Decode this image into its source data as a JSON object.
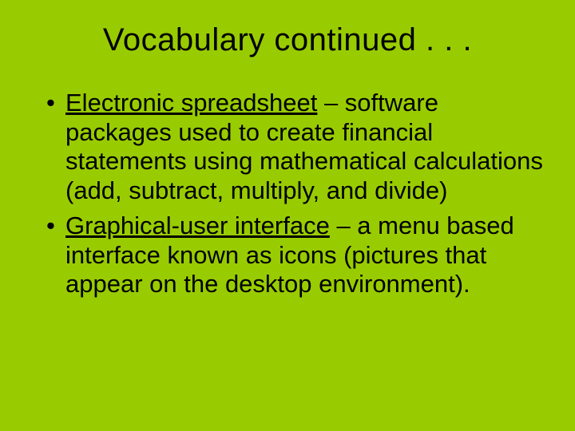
{
  "title": "Vocabulary continued . . .",
  "items": [
    {
      "term": "Electronic spreadsheet",
      "definition": " – software packages used to create financial statements using mathematical calculations (add, subtract, multiply, and divide)"
    },
    {
      "term": "Graphical-user interface",
      "definition": " – a menu based interface known as icons (pictures that appear on the desktop environment)."
    }
  ]
}
